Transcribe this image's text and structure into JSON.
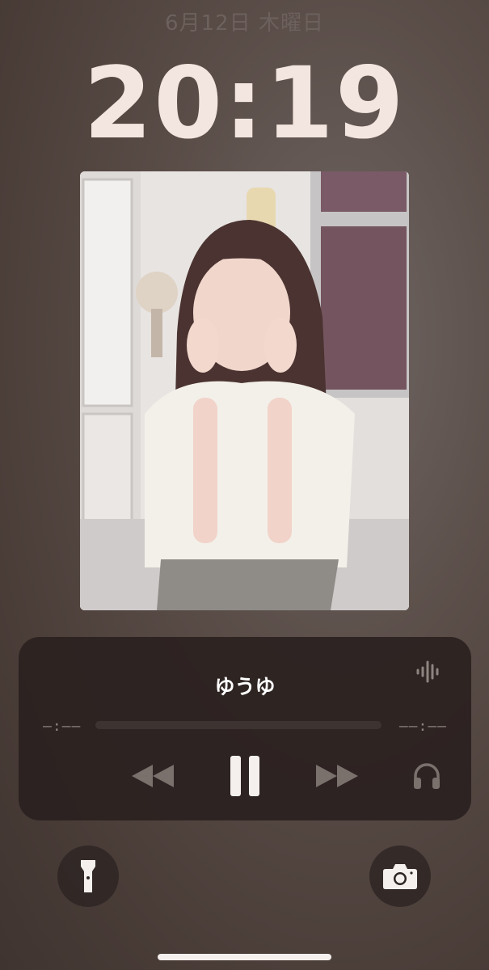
{
  "lockscreen": {
    "date": "6月12日 木曜日",
    "time": "20:19"
  },
  "now_playing": {
    "title": "ゆうゆ",
    "elapsed": "–:––",
    "remaining": "––:––",
    "progress": 0,
    "airplay_icon": "waveform-icon",
    "controls": [
      "rewind-icon",
      "pause-icon",
      "fast-forward-icon",
      "headphones-icon"
    ]
  },
  "quick_actions": [
    "flashlight-icon",
    "camera-icon"
  ],
  "colors": {
    "clock": "#f3e5df",
    "player_bg": "#2a211f",
    "control_inactive": "#7a706c",
    "control_active": "#f5f0ee"
  }
}
